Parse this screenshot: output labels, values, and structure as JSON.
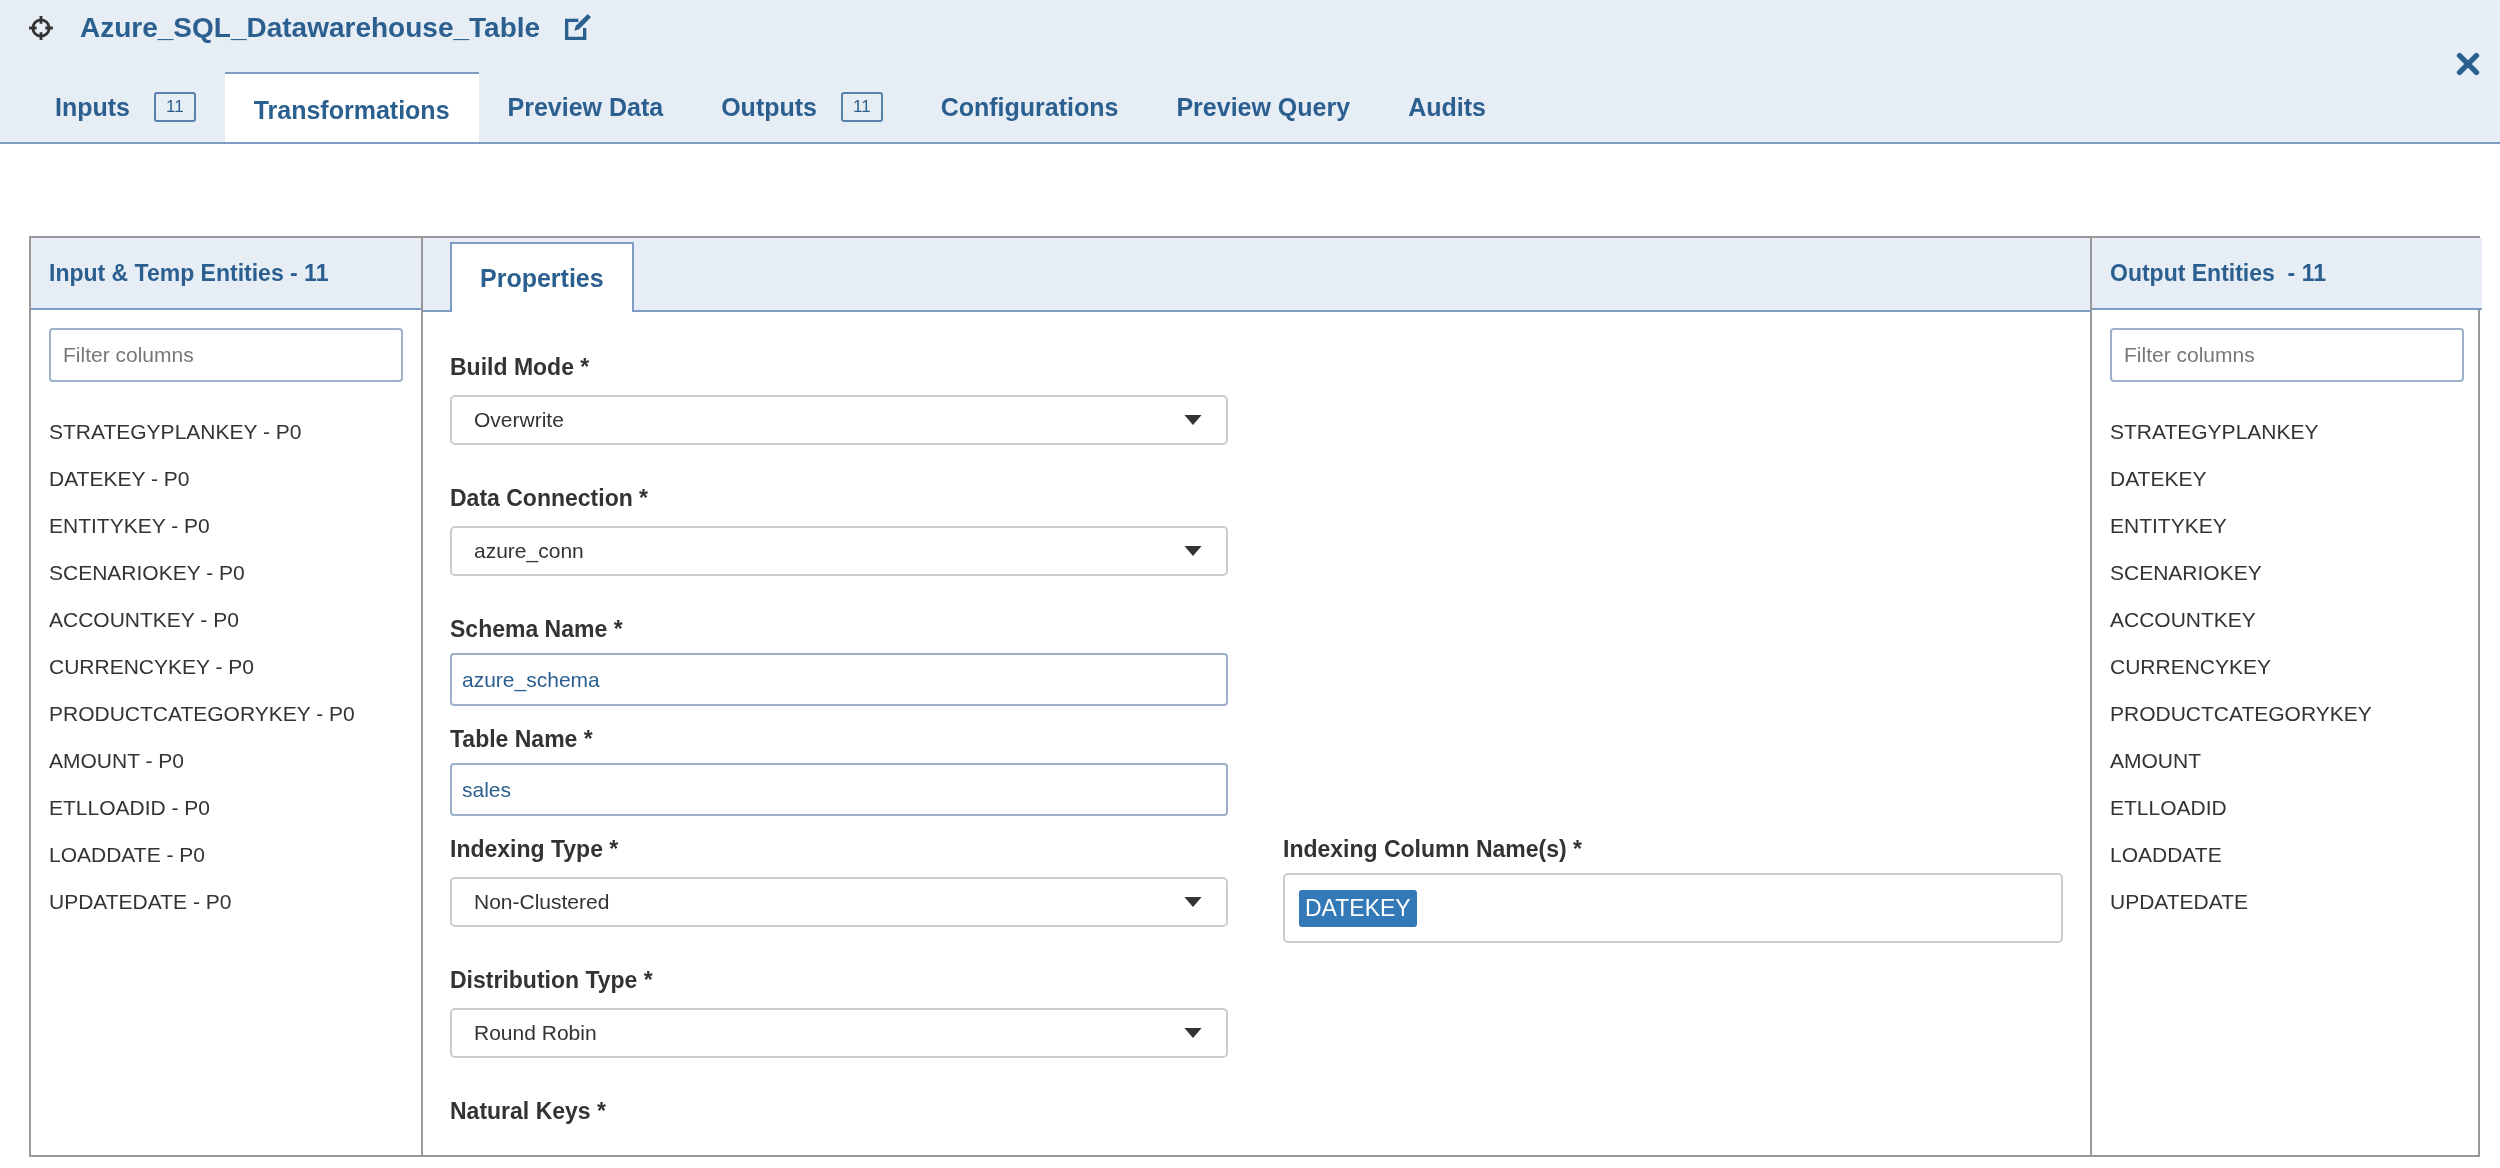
{
  "window": {
    "title": "Azure_SQL_Datawarehouse_Table"
  },
  "tabs": [
    {
      "label": "Inputs",
      "badge": "11",
      "selected": false
    },
    {
      "label": "Transformations",
      "selected": true
    },
    {
      "label": "Preview Data",
      "selected": false
    },
    {
      "label": "Outputs",
      "badge": "11",
      "selected": false
    },
    {
      "label": "Configurations",
      "selected": false
    },
    {
      "label": "Preview Query",
      "selected": false
    },
    {
      "label": "Audits",
      "selected": false
    }
  ],
  "input_panel": {
    "title": "Input & Temp Entities - 11",
    "filter": {
      "placeholder": "Filter columns"
    },
    "items": [
      "STRATEGYPLANKEY - P0",
      "DATEKEY - P0",
      "ENTITYKEY - P0",
      "SCENARIOKEY - P0",
      "ACCOUNTKEY - P0",
      "CURRENCYKEY - P0",
      "PRODUCTCATEGORYKEY - P0",
      "AMOUNT - P0",
      "ETLLOADID - P0",
      "LOADDATE - P0",
      "UPDATEDATE - P0"
    ]
  },
  "center_tabs": [
    {
      "label": "Properties",
      "selected": true
    }
  ],
  "form": [
    {
      "kind": "select",
      "label": "Build Mode *",
      "value": "Overwrite"
    },
    {
      "kind": "select",
      "label": "Data Connection *",
      "value": "azure_conn"
    },
    {
      "kind": "input",
      "label": "Schema Name *",
      "value": "azure_schema"
    },
    {
      "kind": "input",
      "label": "Table Name *",
      "value": "sales"
    },
    {
      "kind": "select",
      "label": "Indexing Type *",
      "value": "Non-Clustered",
      "side": {
        "label": "Indexing Column Name(s) *",
        "tags": [
          "DATEKEY"
        ]
      }
    },
    {
      "kind": "select",
      "label": "Distribution Type *",
      "value": "Round Robin"
    },
    {
      "kind": "heading",
      "label": "Natural Keys *"
    }
  ],
  "output_panel": {
    "title": "Output Entities  - 11",
    "filter": {
      "placeholder": "Filter columns"
    },
    "items": [
      "STRATEGYPLANKEY",
      "DATEKEY",
      "ENTITYKEY",
      "SCENARIOKEY",
      "ACCOUNTKEY",
      "CURRENCYKEY",
      "PRODUCTCATEGORYKEY",
      "AMOUNT",
      "ETLLOADID",
      "LOADDATE",
      "UPDATEDATE"
    ]
  }
}
